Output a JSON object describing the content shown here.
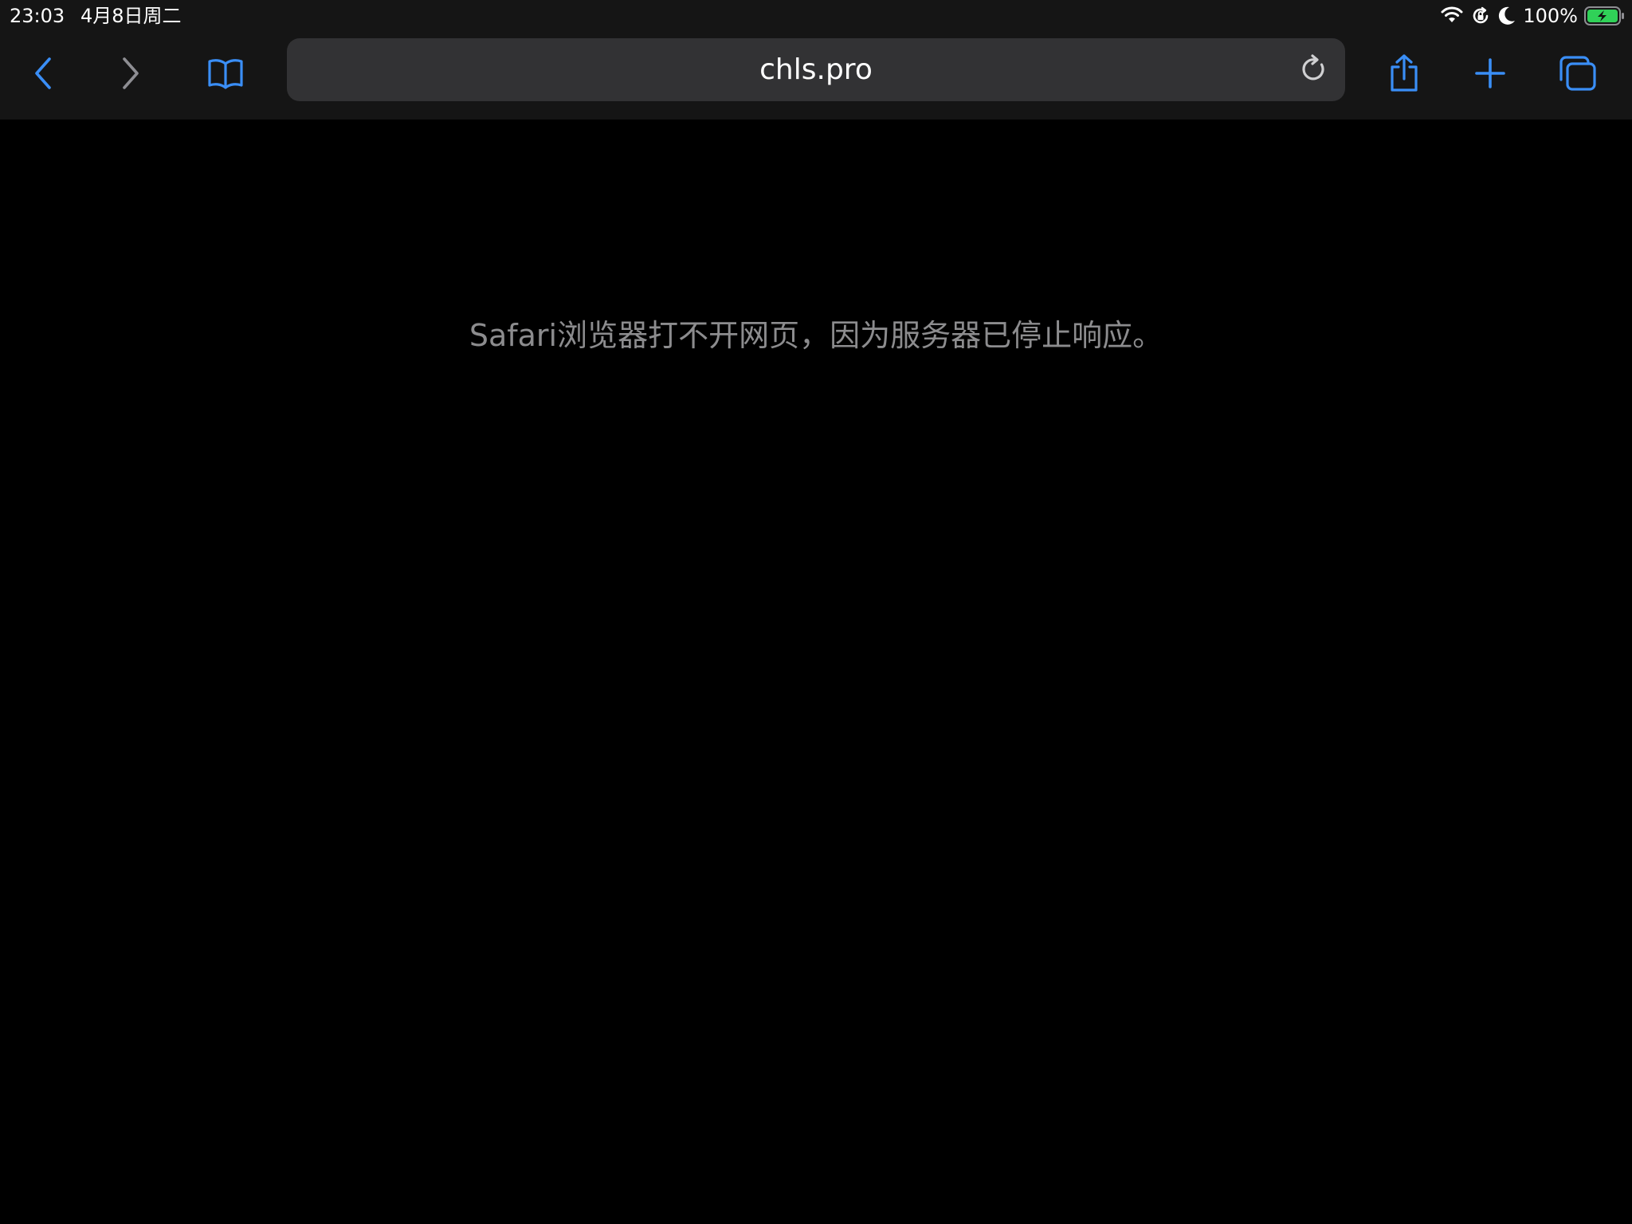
{
  "status_bar": {
    "time": "23:03",
    "date": "4月8日周二",
    "battery_percent": "100%",
    "icons": [
      "wifi-icon",
      "orientation-lock-icon",
      "moon-icon",
      "battery-charging-icon"
    ],
    "battery_color": "#30d158"
  },
  "toolbar": {
    "url": "chls.pro",
    "accent_color": "#3a8ef6",
    "icons": [
      "back-chevron-icon",
      "forward-chevron-icon",
      "bookmarks-book-icon",
      "reload-icon",
      "share-icon",
      "plus-icon",
      "tabs-icon"
    ]
  },
  "content": {
    "error_message": "Safari浏览器打不开网页，因为服务器已停止响应。"
  }
}
